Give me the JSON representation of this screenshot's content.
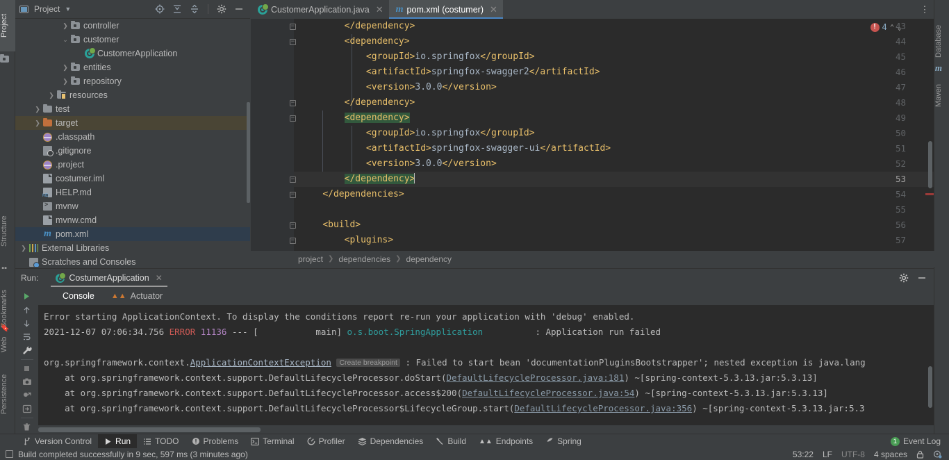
{
  "left_tool_strip": [
    {
      "label": "Project",
      "icon": "project-icon",
      "selected": true
    },
    {
      "label": "Structure",
      "icon": "structure-icon",
      "selected": false
    },
    {
      "label": "Bookmarks",
      "icon": "bookmarks-icon",
      "selected": false
    },
    {
      "label": "Web",
      "icon": "web-icon",
      "selected": false
    },
    {
      "label": "Persistence",
      "icon": "persistence-icon",
      "selected": false
    }
  ],
  "right_tool_strip": [
    {
      "label": "Database",
      "icon": "database-icon"
    },
    {
      "label": "Maven",
      "icon": "maven-icon"
    }
  ],
  "project_panel": {
    "title": "Project",
    "dropdown_icon": "chevron-down-icon",
    "header_icons": [
      "locate-icon",
      "expand-all-icon",
      "collapse-all-icon",
      "gear-icon",
      "minimize-icon"
    ],
    "tree": [
      {
        "label": "controller",
        "indent": 3,
        "arrow": "right",
        "icon": "folder-package-icon",
        "state": "normal"
      },
      {
        "label": "customer",
        "indent": 3,
        "arrow": "down",
        "icon": "folder-package-icon",
        "state": "normal"
      },
      {
        "label": "CustomerApplication",
        "indent": 4,
        "arrow": "none",
        "icon": "spring-boot-class-icon",
        "state": "normal"
      },
      {
        "label": "entities",
        "indent": 3,
        "arrow": "right",
        "icon": "folder-package-icon",
        "state": "normal"
      },
      {
        "label": "repository",
        "indent": 3,
        "arrow": "right",
        "icon": "folder-package-icon",
        "state": "normal"
      },
      {
        "label": "resources",
        "indent": 2,
        "arrow": "right",
        "icon": "folder-resources-icon",
        "state": "normal"
      },
      {
        "label": "test",
        "indent": 1,
        "arrow": "right",
        "icon": "folder-icon",
        "state": "normal"
      },
      {
        "label": "target",
        "indent": 1,
        "arrow": "right",
        "icon": "folder-excluded-icon",
        "state": "highlighted"
      },
      {
        "label": ".classpath",
        "indent": 1,
        "arrow": "none",
        "icon": "xml-file-icon",
        "state": "normal"
      },
      {
        "label": ".gitignore",
        "indent": 1,
        "arrow": "none",
        "icon": "gitignore-file-icon",
        "state": "normal"
      },
      {
        "label": ".project",
        "indent": 1,
        "arrow": "none",
        "icon": "xml-file-icon",
        "state": "normal"
      },
      {
        "label": "costumer.iml",
        "indent": 1,
        "arrow": "none",
        "icon": "iml-file-icon",
        "state": "normal"
      },
      {
        "label": "HELP.md",
        "indent": 1,
        "arrow": "none",
        "icon": "markdown-file-icon",
        "state": "normal"
      },
      {
        "label": "mvnw",
        "indent": 1,
        "arrow": "none",
        "icon": "shell-script-icon",
        "state": "normal"
      },
      {
        "label": "mvnw.cmd",
        "indent": 1,
        "arrow": "none",
        "icon": "cmd-file-icon",
        "state": "normal"
      },
      {
        "label": "pom.xml",
        "indent": 1,
        "arrow": "none",
        "icon": "maven-pom-icon",
        "state": "selected"
      },
      {
        "label": "External Libraries",
        "indent": 0,
        "arrow": "right",
        "icon": "libraries-icon",
        "state": "normal"
      },
      {
        "label": "Scratches and Consoles",
        "indent": 0,
        "arrow": "none",
        "icon": "scratches-icon",
        "state": "normal"
      }
    ]
  },
  "editor_tabs": [
    {
      "label": "CustomerApplication.java",
      "icon": "spring-boot-class-icon",
      "active": false,
      "close_icon": "close-icon"
    },
    {
      "label": "pom.xml (costumer)",
      "icon": "maven-pom-icon",
      "active": true,
      "close_icon": "close-icon"
    }
  ],
  "editor": {
    "overflow_menu_icon": "more-vertical-icon",
    "inspection": {
      "error_icon": "error-icon",
      "error_count": "4",
      "prev_icon": "chevron-up-icon",
      "next_icon": "chevron-down-icon"
    },
    "first_line_number": 43,
    "current_line_number": 53,
    "lines": [
      {
        "n": 43,
        "fold": "minus",
        "indent": 8,
        "segments": [
          {
            "t": "tag",
            "v": "</dependency>"
          }
        ]
      },
      {
        "n": 44,
        "fold": "plus",
        "indent": 8,
        "segments": [
          {
            "t": "tag",
            "v": "<dependency>"
          }
        ]
      },
      {
        "n": 45,
        "fold": "",
        "indent": 12,
        "segments": [
          {
            "t": "tag",
            "v": "<groupId>"
          },
          {
            "t": "txt",
            "v": "io.springfox"
          },
          {
            "t": "tag",
            "v": "</groupId>"
          }
        ]
      },
      {
        "n": 46,
        "fold": "",
        "indent": 12,
        "segments": [
          {
            "t": "tag",
            "v": "<artifactId>"
          },
          {
            "t": "txt",
            "v": "springfox-swagger2"
          },
          {
            "t": "tag",
            "v": "</artifactId>"
          }
        ]
      },
      {
        "n": 47,
        "fold": "",
        "indent": 12,
        "segments": [
          {
            "t": "tag",
            "v": "<version>"
          },
          {
            "t": "txt",
            "v": "3.0.0"
          },
          {
            "t": "tag",
            "v": "</version>"
          }
        ]
      },
      {
        "n": 48,
        "fold": "minus",
        "indent": 8,
        "segments": [
          {
            "t": "tag",
            "v": "</dependency>"
          }
        ]
      },
      {
        "n": 49,
        "fold": "plus",
        "indent": 8,
        "segments": [
          {
            "t": "tag-mark",
            "v": "<dependency>"
          }
        ]
      },
      {
        "n": 50,
        "fold": "",
        "indent": 12,
        "segments": [
          {
            "t": "tag",
            "v": "<groupId>"
          },
          {
            "t": "txt",
            "v": "io.springfox"
          },
          {
            "t": "tag",
            "v": "</groupId>"
          }
        ]
      },
      {
        "n": 51,
        "fold": "",
        "indent": 12,
        "segments": [
          {
            "t": "tag",
            "v": "<artifactId>"
          },
          {
            "t": "txt",
            "v": "springfox-swagger-ui"
          },
          {
            "t": "tag",
            "v": "</artifactId>"
          }
        ]
      },
      {
        "n": 52,
        "fold": "",
        "indent": 12,
        "segments": [
          {
            "t": "tag",
            "v": "<version>"
          },
          {
            "t": "txt",
            "v": "3.0.0"
          },
          {
            "t": "tag",
            "v": "</version>"
          }
        ]
      },
      {
        "n": 53,
        "fold": "minus",
        "indent": 8,
        "current": true,
        "caret": true,
        "segments": [
          {
            "t": "tag-mark",
            "v": "</dependency>"
          }
        ]
      },
      {
        "n": 54,
        "fold": "minus",
        "indent": 4,
        "segments": [
          {
            "t": "tag",
            "v": "</dependencies>"
          }
        ]
      },
      {
        "n": 55,
        "fold": "",
        "indent": 0,
        "segments": []
      },
      {
        "n": 56,
        "fold": "plus",
        "indent": 4,
        "segments": [
          {
            "t": "tag",
            "v": "<build>"
          }
        ]
      },
      {
        "n": 57,
        "fold": "plus",
        "indent": 8,
        "segments": [
          {
            "t": "tag",
            "v": "<plugins>"
          }
        ]
      }
    ]
  },
  "breadcrumb": [
    "project",
    "dependencies",
    "dependency"
  ],
  "run_panel": {
    "label": "Run:",
    "tab": {
      "label": "CostumerApplication",
      "icon": "spring-boot-run-icon",
      "close_icon": "close-icon"
    },
    "header_icons": [
      "gear-icon",
      "minimize-icon"
    ],
    "sub_tabs": [
      {
        "label": "Console",
        "icon": "",
        "active": true
      },
      {
        "label": "Actuator",
        "icon": "actuator-icon",
        "active": false
      }
    ],
    "toolbar_icons": [
      "rerun-icon",
      "scroll-up-icon",
      "scroll-down-icon",
      "soft-wrap-icon",
      "wrench-icon",
      "stop-icon",
      "screenshot-icon",
      "thread-dump-icon",
      "export-icon",
      "trash-icon"
    ],
    "console_lines": [
      {
        "segments": [
          {
            "t": "plain",
            "v": "Error starting ApplicationContext. To display the conditions report re-run your application with 'debug' enabled."
          }
        ]
      },
      {
        "segments": [
          {
            "t": "plain",
            "v": "2021-12-07 07:06:34.756 "
          },
          {
            "t": "red",
            "v": "ERROR"
          },
          {
            "t": "plain",
            "v": " "
          },
          {
            "t": "magenta",
            "v": "11136"
          },
          {
            "t": "plain",
            "v": " --- ["
          },
          {
            "t": "plain",
            "v": "           main] "
          },
          {
            "t": "cyan",
            "v": "o.s.boot.SpringApplication"
          },
          {
            "t": "plain",
            "v": "          : Application run failed"
          }
        ]
      },
      {
        "segments": [
          {
            "t": "plain",
            "v": ""
          }
        ]
      },
      {
        "segments": [
          {
            "t": "plain",
            "v": "org.springframework.context."
          },
          {
            "t": "link",
            "v": "ApplicationContextException"
          },
          {
            "t": "hint",
            "v": "Create breakpoint"
          },
          {
            "t": "plain",
            "v": " : Failed to start bean 'documentationPluginsBootstrapper'; nested exception is java.lang"
          }
        ]
      },
      {
        "segments": [
          {
            "t": "plain",
            "v": "    at org.springframework.context.support.DefaultLifecycleProcessor.doStart("
          },
          {
            "t": "link2",
            "v": "DefaultLifecycleProcessor.java:181"
          },
          {
            "t": "plain",
            "v": ") ~[spring-context-5.3.13.jar:5.3.13]"
          }
        ]
      },
      {
        "segments": [
          {
            "t": "plain",
            "v": "    at org.springframework.context.support.DefaultLifecycleProcessor.access$200("
          },
          {
            "t": "link2",
            "v": "DefaultLifecycleProcessor.java:54"
          },
          {
            "t": "plain",
            "v": ") ~[spring-context-5.3.13.jar:5.3.13]"
          }
        ]
      },
      {
        "segments": [
          {
            "t": "plain",
            "v": "    at org.springframework.context.support.DefaultLifecycleProcessor$LifecycleGroup.start("
          },
          {
            "t": "link2",
            "v": "DefaultLifecycleProcessor.java:356"
          },
          {
            "t": "plain",
            "v": ") ~[spring-context-5.3.13.jar:5.3"
          }
        ]
      }
    ]
  },
  "bottom_bar": {
    "items": [
      {
        "label": "Version Control",
        "icon": "branch-icon",
        "selected": false
      },
      {
        "label": "Run",
        "icon": "run-icon",
        "selected": true
      },
      {
        "label": "TODO",
        "icon": "todo-icon",
        "selected": false
      },
      {
        "label": "Problems",
        "icon": "problems-icon",
        "selected": false
      },
      {
        "label": "Terminal",
        "icon": "terminal-icon",
        "selected": false
      },
      {
        "label": "Profiler",
        "icon": "profiler-icon",
        "selected": false
      },
      {
        "label": "Dependencies",
        "icon": "dependencies-icon",
        "selected": false
      },
      {
        "label": "Build",
        "icon": "build-icon",
        "selected": false
      },
      {
        "label": "Endpoints",
        "icon": "endpoints-icon",
        "selected": false
      },
      {
        "label": "Spring",
        "icon": "spring-icon",
        "selected": false
      }
    ],
    "event_log": {
      "label": "Event Log",
      "count": "1",
      "badge_color": "#499c54"
    }
  },
  "status_bar": {
    "message": "Build completed successfully in 9 sec, 597 ms (3 minutes ago)",
    "build_icon": "build-status-icon",
    "caret_position": "53:22",
    "line_separator": "LF",
    "encoding": "UTF-8",
    "indent": "4 spaces",
    "lock_icon": "lock-icon",
    "vcs_icon": "git-branch-icon"
  },
  "colors": {
    "background": "#3c3f41",
    "editor_background": "#2b2b2b",
    "accent": "#4a88c7",
    "error": "#c75450",
    "tag": "#e8bf6a",
    "selection": "#32593d"
  }
}
